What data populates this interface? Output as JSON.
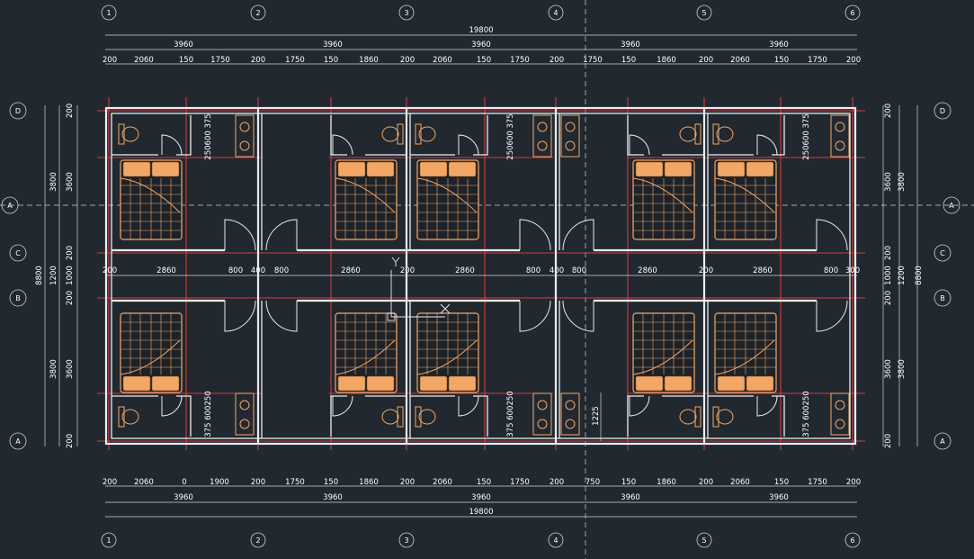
{
  "drawing": {
    "grid_top": [
      "1",
      "2",
      "3",
      "4",
      "5",
      "6"
    ],
    "grid_bottom": [
      "1",
      "2",
      "3",
      "4",
      "5",
      "6"
    ],
    "grid_left": [
      "D",
      "A",
      "C",
      "B",
      "A"
    ],
    "grid_right": [
      "D",
      "A",
      "C",
      "B",
      "A"
    ]
  },
  "dims_top": {
    "total": "19800",
    "bays": [
      "3960",
      "3960",
      "3960",
      "3960",
      "3960"
    ],
    "detail": [
      "200",
      "2060",
      "150",
      "1750",
      "200",
      "1750",
      "150",
      "1860",
      "200",
      "2060",
      "150",
      "1750",
      "200",
      "1750",
      "150",
      "1860",
      "200",
      "2060",
      "150",
      "1750",
      "200"
    ]
  },
  "dims_bottom": {
    "total": "19800",
    "bays": [
      "3960",
      "3960",
      "3960",
      "3960",
      "3960"
    ],
    "detail": [
      "200",
      "2060",
      "0",
      "1900",
      "200",
      "1750",
      "150",
      "1860",
      "200",
      "2060",
      "150",
      "1750",
      "200",
      "750",
      "150",
      "1860",
      "200",
      "2060",
      "150",
      "1750",
      "200"
    ]
  },
  "dims_middle": [
    "200",
    "2860",
    "800",
    "400",
    "800",
    "2860",
    "200",
    "2860",
    "800",
    "400",
    "800",
    "2860",
    "200",
    "2860",
    "800",
    "300"
  ],
  "dims_left": {
    "total": "8800",
    "outer": [
      "3800",
      "1200",
      "3800"
    ],
    "inner": [
      "200",
      "3600",
      "200",
      "1000",
      "200",
      "3600",
      "200"
    ]
  },
  "dims_right": {
    "total": "8800",
    "outer": [
      "3800",
      "1200",
      "3800"
    ],
    "inner": [
      "200",
      "3600",
      "200",
      "1000",
      "200",
      "3600",
      "200"
    ]
  },
  "dims_bath": {
    "upper": [
      "2506003 75",
      "2506003 75",
      "2506003 75"
    ],
    "upper_text": "250600 375",
    "lower_text": "375 600250",
    "stair": "1225"
  },
  "colors": {
    "background": "#212830",
    "walls": "#e9edf1",
    "furniture": "#f2a766",
    "axis": "#d53a3a",
    "dimension": "#cfd3d8"
  }
}
